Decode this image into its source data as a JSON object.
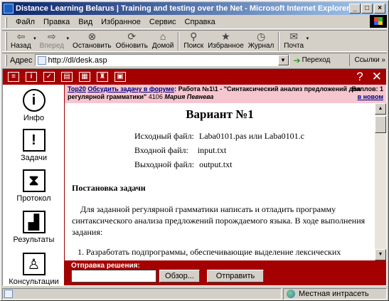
{
  "window": {
    "title": "Distance Learning Belarus | Training and testing over the Net - Microsoft Internet Explorer",
    "buttons": {
      "minimize": "_",
      "maximize": "□",
      "close": "×"
    }
  },
  "menu": {
    "items": [
      "Файл",
      "Правка",
      "Вид",
      "Избранное",
      "Сервис",
      "Справка"
    ]
  },
  "toolbar": {
    "buttons": [
      {
        "label": "Назад",
        "icon": "back-arrow-icon",
        "glyph": "⇦"
      },
      {
        "label": "Вперед",
        "icon": "forward-arrow-icon",
        "glyph": "⇨"
      },
      {
        "label": "Остановить",
        "icon": "stop-icon",
        "glyph": "⊗"
      },
      {
        "label": "Обновить",
        "icon": "refresh-icon",
        "glyph": "⟳"
      },
      {
        "label": "Домой",
        "icon": "home-icon",
        "glyph": "⌂"
      },
      {
        "label": "Поиск",
        "icon": "search-icon",
        "glyph": "⚲"
      },
      {
        "label": "Избранное",
        "icon": "favorites-icon",
        "glyph": "★"
      },
      {
        "label": "Журнал",
        "icon": "history-icon",
        "glyph": "◷"
      },
      {
        "label": "Почта",
        "icon": "mail-icon",
        "glyph": "✉"
      }
    ]
  },
  "address": {
    "label": "Адрес",
    "url": "http://dl/desk.asp",
    "go_label": "Переход",
    "links_label": "Ссылки »"
  },
  "app": {
    "toolbar_icons": [
      "list-icon",
      "info-icon",
      "checkbox-icon",
      "document-icon",
      "grid-icon",
      "people-icon",
      "notes-icon"
    ],
    "toolbar_glyphs": [
      "≡",
      "i",
      "✓",
      "▤",
      "▦",
      "♜",
      "▣"
    ],
    "help_glyph": "?",
    "close_glyph": "✕"
  },
  "sidebar": {
    "items": [
      {
        "label": "Инфо",
        "glyph": "i"
      },
      {
        "label": "Задачи",
        "glyph": "!"
      },
      {
        "label": "Протокол",
        "glyph": "⧗"
      },
      {
        "label": "Результаты",
        "glyph": "▟"
      },
      {
        "label": "Консультации",
        "glyph": "♙"
      }
    ]
  },
  "infobar": {
    "top20": "Top20",
    "discuss": "Обсудить задачу в форуме",
    "work": "Работа №1\\1 - \"Синтаксический анализ предложений для регулярной грамматики\"",
    "code": "4106",
    "author": "Мария Певнева",
    "score_label": "Баллов: 1",
    "new_link": "в новом"
  },
  "document": {
    "title": "Вариант №1",
    "files": [
      {
        "label": "Исходный файл:",
        "value": "Laba0101.pas или Laba0101.c"
      },
      {
        "label": "Входной файл:",
        "value": "input.txt"
      },
      {
        "label": "Выходной файл:",
        "value": "output.txt"
      }
    ],
    "section_heading": "Постановка задачи",
    "paragraph": "Для заданной регулярной грамматики написать и отладить программу синтаксического анализа предложений порождаемого языка. В ходе выполнения задания:",
    "list_items": [
      "Разработать подпрограммы, обеспечивающие выделение лексических"
    ]
  },
  "submit": {
    "label": "Отправка решения:",
    "file_value": "",
    "browse_label": "Обзор...",
    "send_label": "Отправить"
  },
  "status": {
    "text": "",
    "zone": "Местная интрасеть"
  }
}
